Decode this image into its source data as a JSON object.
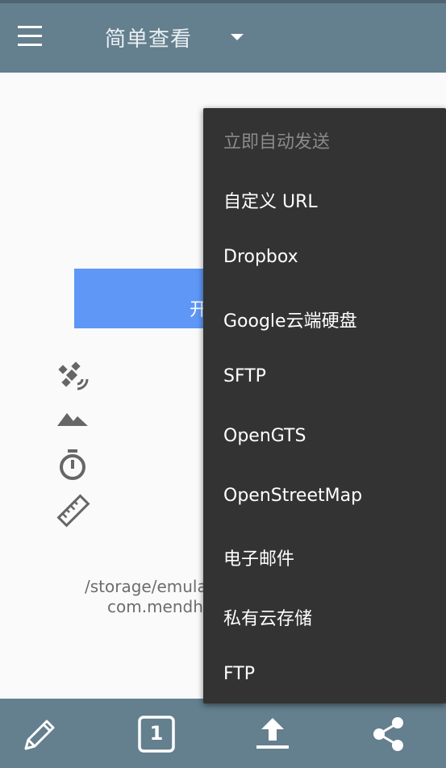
{
  "toolbar": {
    "title": "简单查看"
  },
  "main": {
    "start_button_label": "开始",
    "path_line1": "/storage/emula",
    "path_line2": "com.mendha"
  },
  "popup_menu": {
    "items": [
      "立即自动发送",
      "自定义 URL",
      "Dropbox",
      "Google云端硬盘",
      "SFTP",
      "OpenGTS",
      "OpenStreetMap",
      "电子邮件",
      "私有云存储",
      "FTP"
    ]
  },
  "bottom_bar": {
    "page_number": "1"
  },
  "colors": {
    "toolbar": "#647f8e",
    "accent_button": "#5e97f6",
    "menu_bg": "#333333"
  }
}
